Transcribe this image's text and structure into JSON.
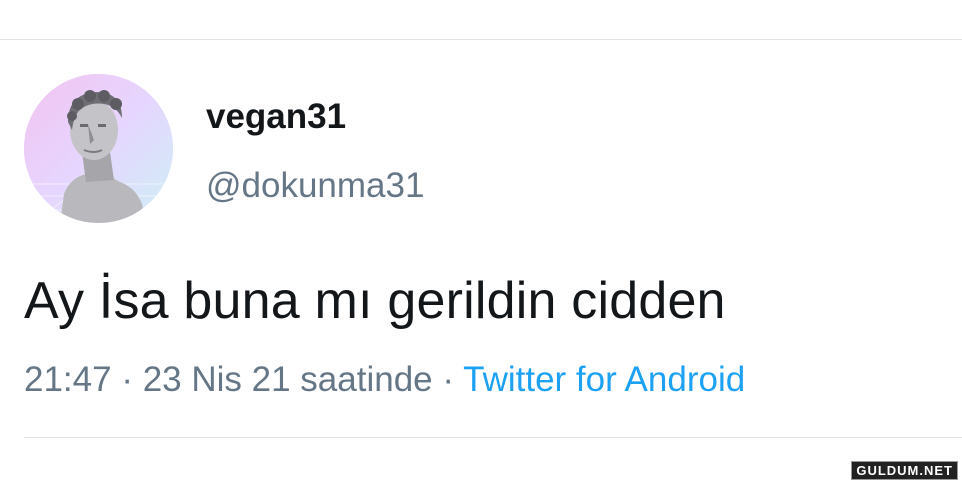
{
  "tweet": {
    "display_name": "vegan31",
    "handle": "@dokunma31",
    "text": "Ay İsa buna mı gerildin cidden",
    "time": "21:47",
    "separator": "·",
    "date": "23 Nis 21 saatinde",
    "source": "Twitter for Android"
  },
  "watermark": "GULDUM.NET",
  "colors": {
    "text": "#14171a",
    "secondary": "#657786",
    "link": "#1da1f2",
    "divider": "#dfe3e6"
  },
  "icons": {
    "avatar": "statue-bust-avatar"
  }
}
